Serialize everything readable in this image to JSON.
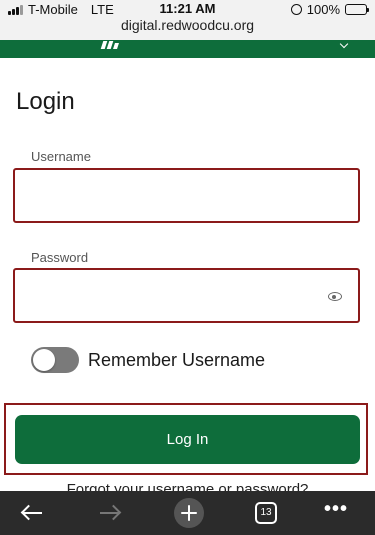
{
  "status_bar": {
    "carrier": "T-Mobile",
    "network": "LTE",
    "time": "11:21 AM",
    "battery": "100%",
    "url": "digital.redwoodcu.org"
  },
  "login": {
    "title": "Login",
    "username_label": "Username",
    "username_value": "",
    "password_label": "Password",
    "password_value": "",
    "remember_label": "Remember Username",
    "remember_on": false,
    "login_button": "Log In",
    "forgot_link": "Forgot your username or password?"
  },
  "toolbar": {
    "tab_count": "13"
  },
  "colors": {
    "brand_green": "#0e6d3b",
    "highlight_red": "#8b1a1a",
    "toolbar_bg": "#2b2b2b"
  },
  "icons": [
    "signal-icon",
    "alarm-icon",
    "battery-icon",
    "logo-icon",
    "chevron-icon",
    "eye-icon",
    "back-arrow-icon",
    "forward-arrow-icon",
    "plus-icon",
    "tabs-icon",
    "more-icon"
  ]
}
